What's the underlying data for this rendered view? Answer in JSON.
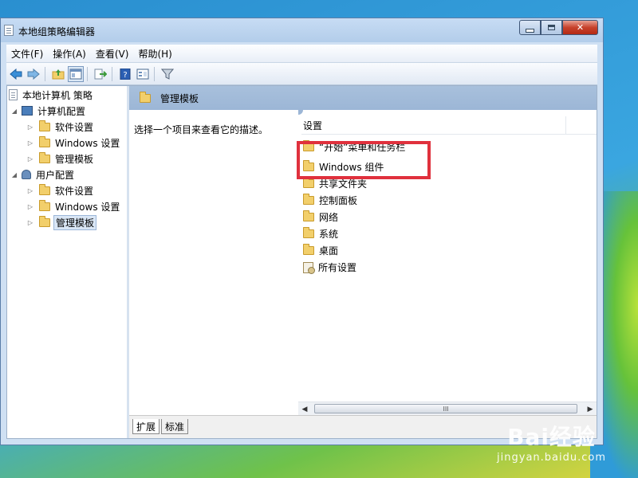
{
  "window": {
    "title": "本地组策略编辑器",
    "controls": {
      "minimize": "minimize",
      "maximize": "maximize",
      "close": "✕"
    }
  },
  "menubar": {
    "items": [
      "文件(F)",
      "操作(A)",
      "查看(V)",
      "帮助(H)"
    ]
  },
  "toolbar": {
    "buttons": [
      "back-icon",
      "forward-icon",
      "up-folder-icon",
      "show-hide-tree-icon",
      "export-icon",
      "help-icon",
      "properties-icon",
      "filter-icon"
    ]
  },
  "tree": {
    "root": "本地计算机 策略",
    "computer_config": "计算机配置",
    "computer_children": [
      "软件设置",
      "Windows 设置",
      "管理模板"
    ],
    "user_config": "用户配置",
    "user_children": [
      "软件设置",
      "Windows 设置",
      "管理模板"
    ],
    "selected": "管理模板"
  },
  "pane": {
    "title": "管理模板",
    "description": "选择一个项目来查看它的描述。",
    "column_header": "设置",
    "items": [
      "“开始”菜单和任务栏",
      "Windows 组件",
      "共享文件夹",
      "控制面板",
      "网络",
      "系统",
      "桌面",
      "所有设置"
    ]
  },
  "scrollbar": {
    "thumb_grip": "III"
  },
  "tabs": [
    "扩展",
    "标准"
  ],
  "watermark": {
    "main": "Bai经验",
    "sub": "jingyan.baidu.com"
  },
  "colors": {
    "highlight_box": "#e0313d",
    "pane_header": "#9cb6d6",
    "close_button": "#c7422c"
  }
}
